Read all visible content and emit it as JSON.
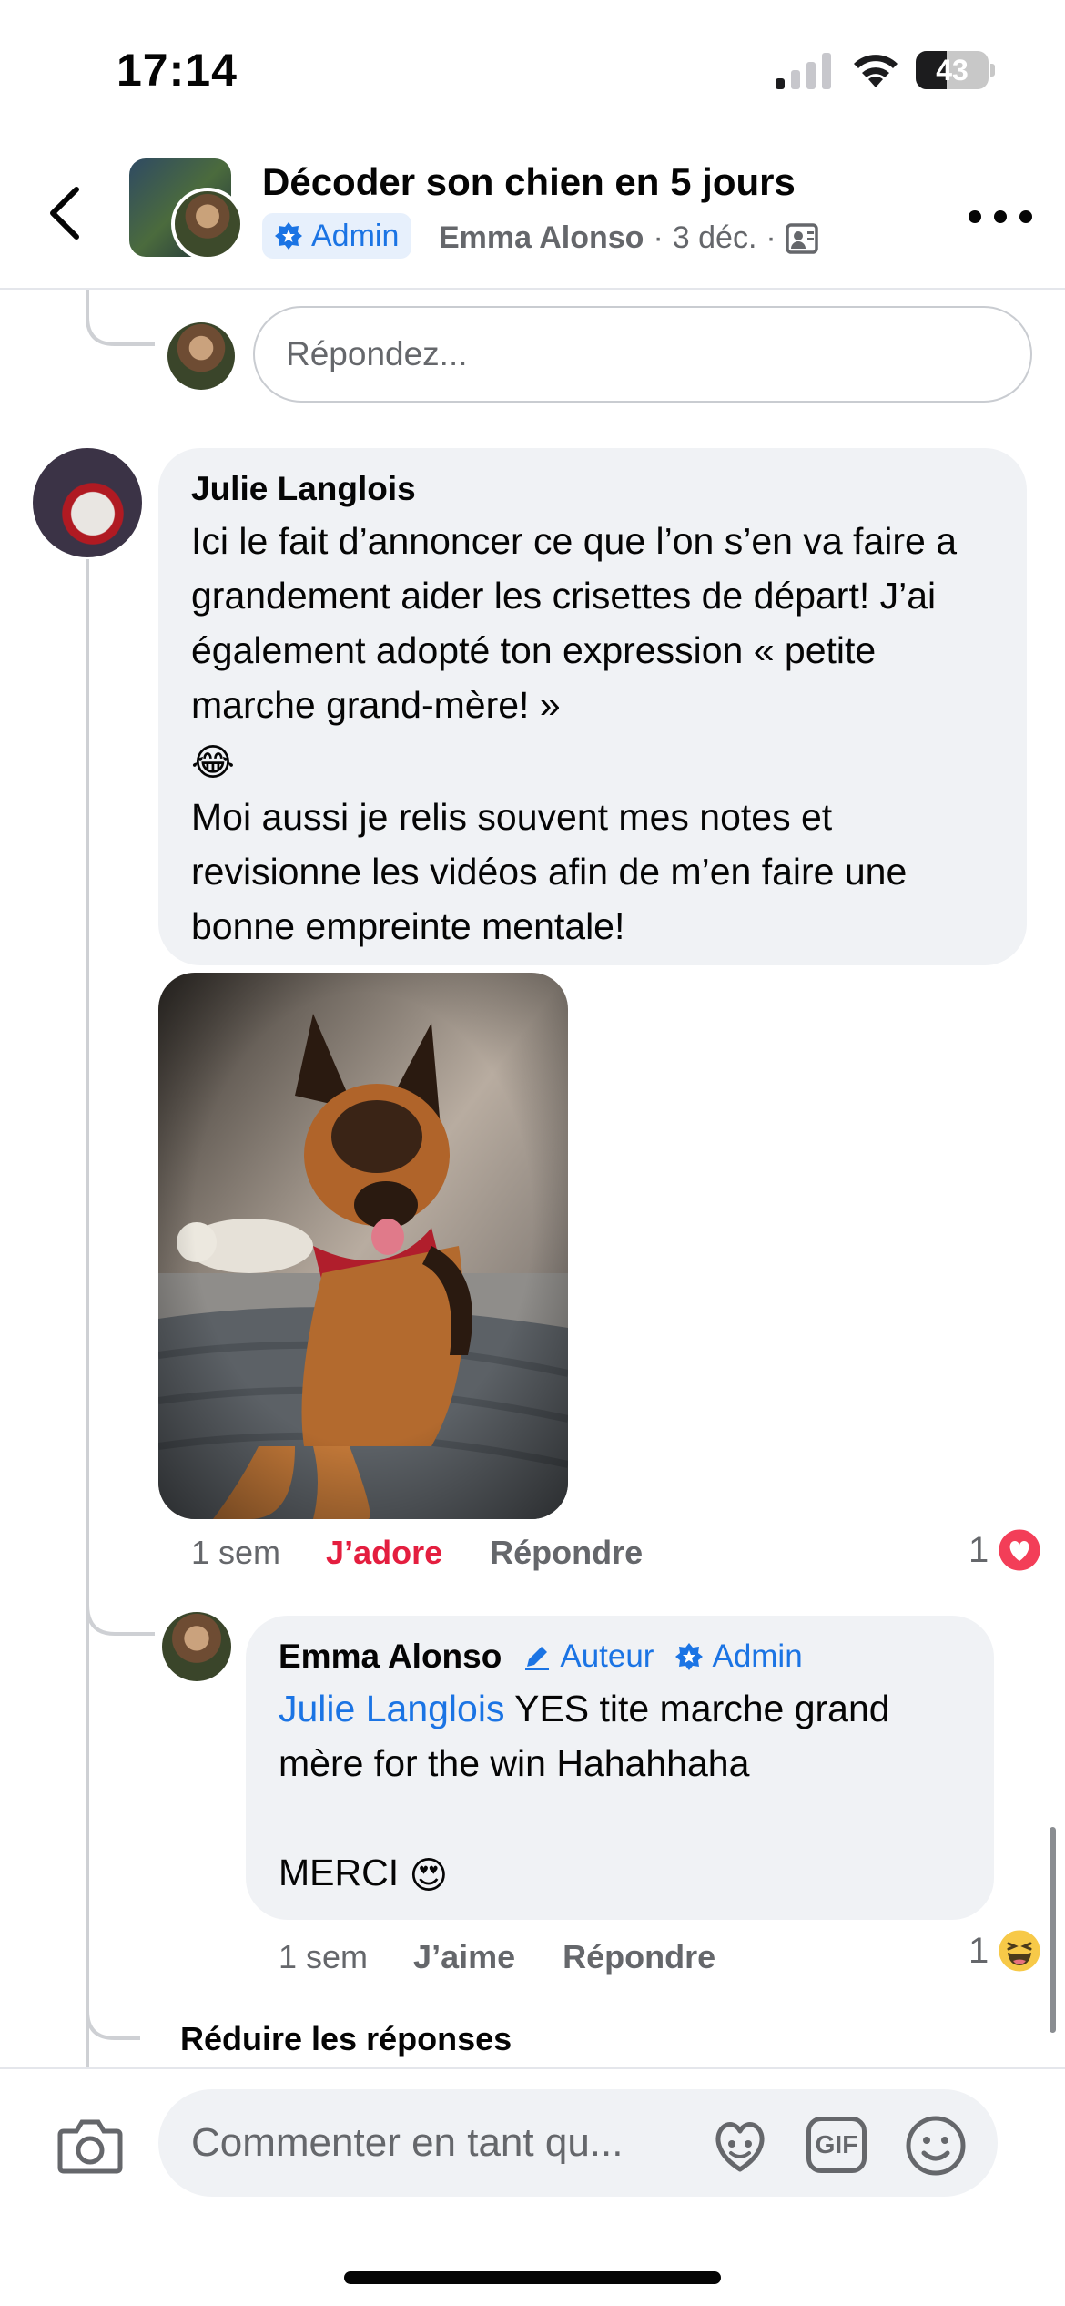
{
  "status_bar": {
    "time": "17:14",
    "battery": "43",
    "battery_level": 0.43
  },
  "header": {
    "title": "Décoder son chien en 5 jours",
    "admin_label": "Admin",
    "author": "Emma Alonso",
    "separator": "·",
    "date": "3 déc.",
    "icons": {
      "back": "chevron-left-icon",
      "privacy": "group-privacy-icon",
      "more": "more-dots-icon"
    }
  },
  "reply_box": {
    "placeholder": "Répondez..."
  },
  "comment": {
    "author": "Julie Langlois",
    "text_1": "Ici le fait d’annoncer ce que l’on s’en va faire a grandement aider les crisettes de départ! J’ai également adopté ton expression « petite marche grand-mère! »",
    "emoji_1": "😂",
    "text_2": "Moi aussi je relis souvent mes notes et revisionne les vidéos afin de m’en faire une bonne empreinte mentale!",
    "photo": "german-shepherd-photo",
    "time": "1 sem",
    "reaction_label": "J’adore",
    "reply_label": "Répondre",
    "reaction_count": "1",
    "reaction_icon": "love-reaction-icon",
    "reaction_color": "#e41e3f"
  },
  "reply": {
    "author": "Emma Alonso",
    "author_tag": "Auteur",
    "admin_tag": "Admin",
    "mention": "Julie Langlois",
    "text_1": "YES tite marche grand mère for the win Hahahhaha",
    "text_2": "MERCI",
    "emoji": "😍",
    "time": "1 sem",
    "like_label": "J’aime",
    "reply_label": "Répondre",
    "reaction_count": "1",
    "reaction_icon": "haha-reaction-icon"
  },
  "collapse_replies": "Réduire les réponses",
  "composer": {
    "placeholder": "Commenter en tant qu...",
    "gif_label": "GIF",
    "icons": {
      "camera": "camera-icon",
      "avatar_sticker": "avatar-sticker-icon",
      "emoji": "emoji-icon"
    }
  },
  "colors": {
    "accent": "#1b74e4",
    "love": "#e41e3f",
    "bubble": "#f0f2f5",
    "secondary_text": "#65676b"
  }
}
